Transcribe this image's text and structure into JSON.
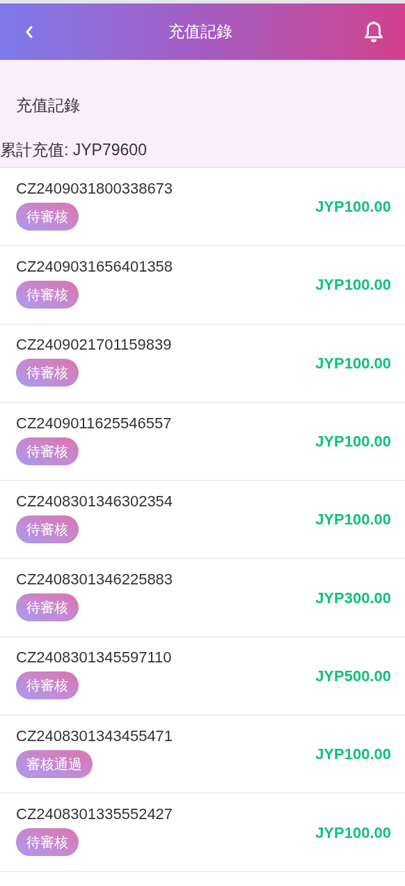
{
  "header": {
    "title": "充值記錄"
  },
  "summary": {
    "title": "充值記錄",
    "total": "累計充值: JYP79600"
  },
  "records": [
    {
      "order_no": "CZ2409031800338673",
      "status": "待審核",
      "amount": "JYP100.00"
    },
    {
      "order_no": "CZ2409031656401358",
      "status": "待審核",
      "amount": "JYP100.00"
    },
    {
      "order_no": "CZ2409021701159839",
      "status": "待審核",
      "amount": "JYP100.00"
    },
    {
      "order_no": "CZ2409011625546557",
      "status": "待審核",
      "amount": "JYP100.00"
    },
    {
      "order_no": "CZ2408301346302354",
      "status": "待審核",
      "amount": "JYP100.00"
    },
    {
      "order_no": "CZ2408301346225883",
      "status": "待審核",
      "amount": "JYP300.00"
    },
    {
      "order_no": "CZ2408301345597110",
      "status": "待審核",
      "amount": "JYP500.00"
    },
    {
      "order_no": "CZ2408301343455471",
      "status": "審核通過",
      "amount": "JYP100.00"
    },
    {
      "order_no": "CZ2408301335552427",
      "status": "待審核",
      "amount": "JYP100.00"
    }
  ]
}
